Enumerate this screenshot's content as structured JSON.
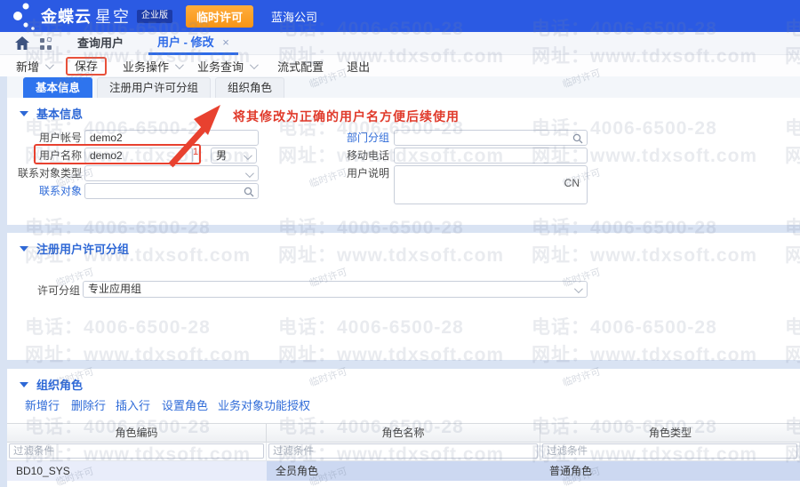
{
  "header": {
    "logo_main": "金蝶云",
    "logo_sub": "星空",
    "edition_badge": "企业版",
    "license_button": "临时许可",
    "company_name": "蓝海公司"
  },
  "tab_bar": {
    "tabs": [
      {
        "label": "查询用户"
      },
      {
        "label": "用户 - 修改",
        "close": "×"
      }
    ]
  },
  "toolbar": {
    "items": [
      {
        "label": "新增",
        "dropdown": true
      },
      {
        "label": "保存",
        "highlighted": true
      },
      {
        "label": "业务操作",
        "dropdown": true
      },
      {
        "label": "业务查询",
        "dropdown": true
      },
      {
        "label": "流式配置"
      },
      {
        "label": "退出"
      }
    ]
  },
  "subtabs": [
    {
      "label": "基本信息",
      "active": true
    },
    {
      "label": "注册用户许可分组",
      "active": false
    },
    {
      "label": "组织角色",
      "active": false
    }
  ],
  "annotation": {
    "text": "将其修改为正确的用户名方便后续使用",
    "marker": "1",
    "color": "#E03A2B"
  },
  "basic_info": {
    "title": "基本信息",
    "account_label": "用户帐号",
    "account_value": "demo2",
    "name_label": "用户名称",
    "name_value": "demo2",
    "gender_value": "男",
    "contact_type_label": "联系对象类型",
    "contact_type_value": "",
    "contact_label": "联系对象",
    "contact_value": "",
    "dept_group_label": "部门分组",
    "dept_group_value": "",
    "mobile_label": "移动电话",
    "mobile_value": "",
    "user_desc_label": "用户说明",
    "user_desc_value": "CN"
  },
  "license_section": {
    "title": "注册用户许可分组",
    "group_label": "许可分组",
    "group_value": "专业应用组"
  },
  "role_section": {
    "title": "组织角色",
    "actions": [
      {
        "label": "新增行"
      },
      {
        "label": "删除行"
      },
      {
        "label": "插入行"
      },
      {
        "label": "设置角色"
      },
      {
        "label": "业务对象功能授权"
      }
    ],
    "table": {
      "columns": [
        "角色编码",
        "角色名称",
        "角色类型"
      ],
      "filter_placeholder": "过滤条件",
      "rows": [
        [
          "BD10_SYS",
          "全员角色",
          "普通角色"
        ]
      ]
    }
  },
  "watermark": {
    "phone": "电话：4006-6500-28",
    "url": "网址：www.tdxsoft.com",
    "license": "临时许可"
  },
  "colors": {
    "header_blue": "#2B5AE3",
    "accent_blue": "#2E6BE8",
    "annotation_red": "#E03A2B",
    "orange_button": "#F79416",
    "selected_row": "#CCD8F1",
    "selected_cell": "#E9EDFA"
  }
}
